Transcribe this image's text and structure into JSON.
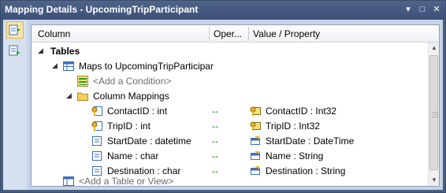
{
  "window": {
    "title": "Mapping Details - UpcomingTripParticipant",
    "btn_dropdown": "▾",
    "btn_restore": "□",
    "btn_close": "✕"
  },
  "grid": {
    "headers": {
      "column": "Column",
      "operator": "Oper...",
      "value": "Value / Property"
    },
    "tables_label": "Tables",
    "maps_to": "Maps to UpcomingTripParticipar",
    "add_condition": "<Add a Condition>",
    "column_mappings": "Column Mappings",
    "arrow_glyph": "↔",
    "mappings": [
      {
        "column": "ContactID : int",
        "property": "ContactID : Int32",
        "key": true
      },
      {
        "column": "TripID : int",
        "property": "TripID : Int32",
        "key": true
      },
      {
        "column": "StartDate : datetime",
        "property": "StartDate : DateTime",
        "key": false
      },
      {
        "column": "Name : char",
        "property": "Name : String",
        "key": false
      },
      {
        "column": "Destination : char",
        "property": "Destination : String",
        "key": false
      }
    ],
    "add_table": "<Add a Table or View>"
  },
  "colors": {
    "title_bar": "#4e6489",
    "link_arrow": "#2d9a2d",
    "placeholder_text": "#6d6d6d"
  }
}
